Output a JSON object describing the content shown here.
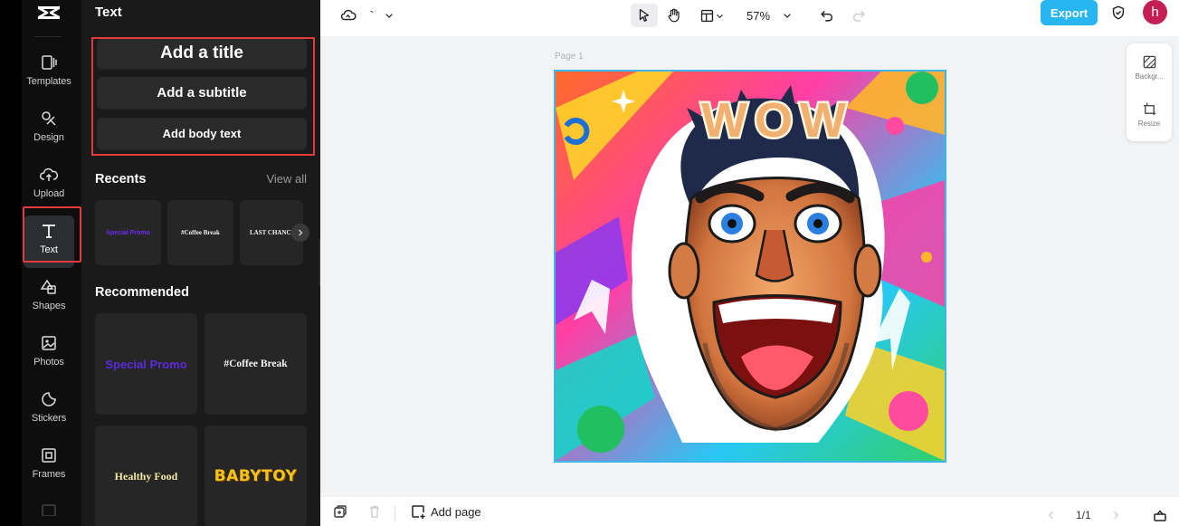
{
  "rail": {
    "items": [
      {
        "label": "Templates",
        "icon": "templates-icon"
      },
      {
        "label": "Design",
        "icon": "design-icon"
      },
      {
        "label": "Upload",
        "icon": "upload-icon"
      },
      {
        "label": "Text",
        "icon": "text-icon",
        "active": true
      },
      {
        "label": "Shapes",
        "icon": "shapes-icon"
      },
      {
        "label": "Photos",
        "icon": "photos-icon"
      },
      {
        "label": "Stickers",
        "icon": "stickers-icon"
      },
      {
        "label": "Frames",
        "icon": "frames-icon"
      }
    ]
  },
  "panel": {
    "title": "Text",
    "add_title": "Add a title",
    "add_subtitle": "Add a subtitle",
    "add_body": "Add body text",
    "recents": {
      "title": "Recents",
      "view_all": "View all",
      "items": [
        "Special Promo",
        "#Coffee Break",
        "LAST CHANCE"
      ]
    },
    "recommended": {
      "title": "Recommended",
      "items": [
        "Special Promo",
        "#Coffee Break",
        "Healthy Food",
        "BABYTOY"
      ]
    }
  },
  "topbar": {
    "title_placeholder": "`",
    "zoom": "57%",
    "export_label": "Export",
    "avatar_initial": "h"
  },
  "canvas": {
    "page_label": "Page 1",
    "image_text": "WOW",
    "side_tools": [
      {
        "label": "Backgr...",
        "icon": "background-icon"
      },
      {
        "label": "Resize",
        "icon": "resize-icon"
      }
    ]
  },
  "bottombar": {
    "add_page": "Add page",
    "pager": "1/1"
  },
  "colors": {
    "accent": "#28b6f2",
    "highlight": "#e23b3b",
    "avatar": "#c41e54"
  }
}
